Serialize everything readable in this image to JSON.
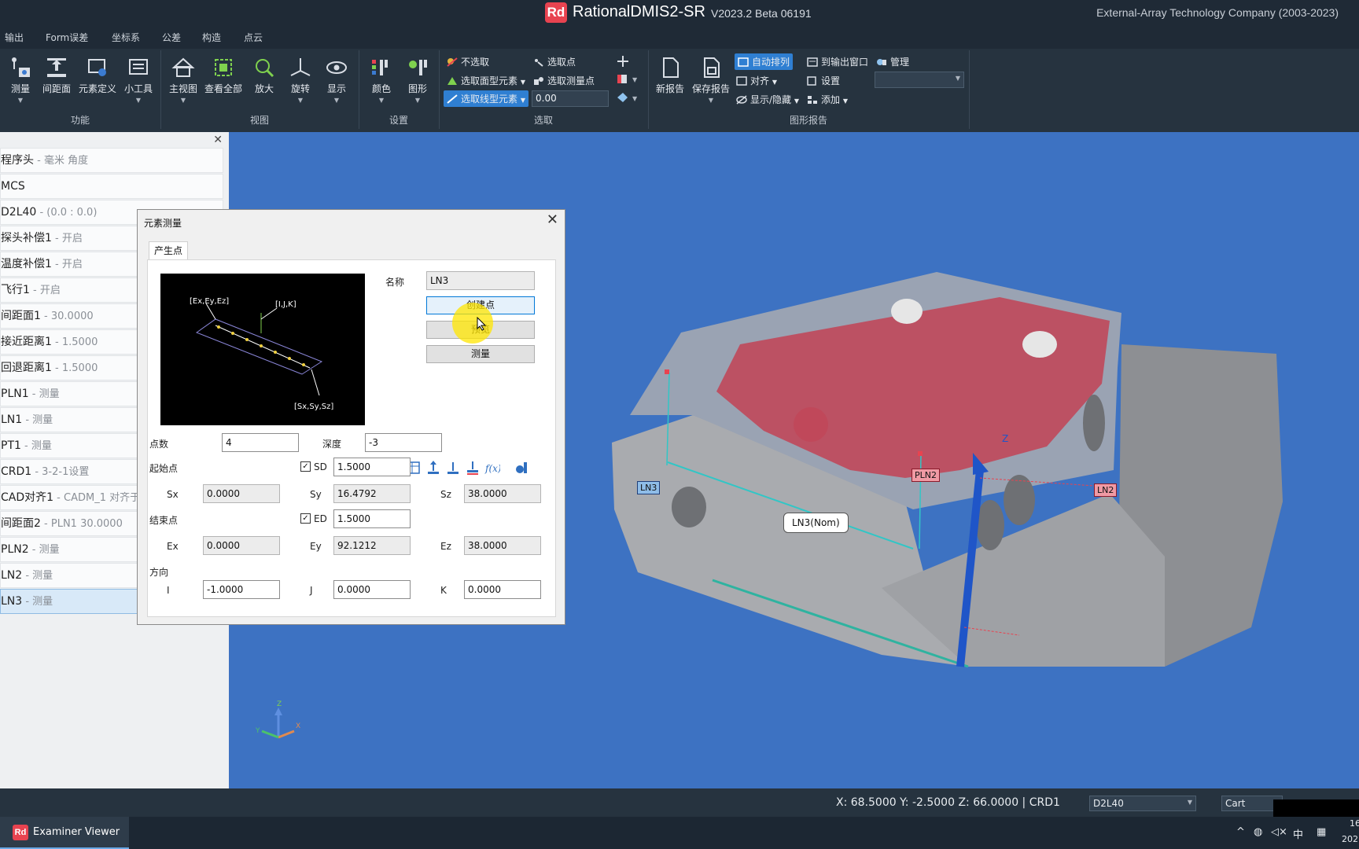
{
  "app": {
    "logo_text": "Rd",
    "title": "RationalDMIS2-SR",
    "version": "V2023.2 Beta 06191",
    "company": "External-Array Technology Company (2003-2023)"
  },
  "menu": [
    "输出",
    "Form误差",
    "坐标系",
    "公差",
    "构造",
    "点云"
  ],
  "ribbon": {
    "function_buttons": [
      "测量",
      "间距面",
      "元素定义",
      "小工具"
    ],
    "function_group": "功能",
    "view_buttons": [
      "主视图",
      "查看全部",
      "放大",
      "旋转",
      "显示"
    ],
    "view_group": "视图",
    "settings_buttons": [
      "颜色",
      "图形"
    ],
    "settings_group": "设置",
    "select_items": {
      "no_select": "不选取",
      "select_point": "选取点",
      "select_surface": "选取面型元素",
      "select_measured_point": "选取测量点",
      "select_linear": "选取线型元素",
      "value": "0.00"
    },
    "select_group": "选取",
    "report_buttons": [
      "新报告",
      "保存报告"
    ],
    "report_items": {
      "auto_arrange": "自动排列",
      "to_output": "到输出窗口",
      "manage": "管理",
      "align": "对齐",
      "settings": "设置",
      "show_hide": "显示/隐藏",
      "add": "添加"
    },
    "report_group": "图形报告"
  },
  "program_tree": [
    {
      "name": "程序头",
      "detail": " - 毫米 角度"
    },
    {
      "name": "MCS",
      "detail": ""
    },
    {
      "name": "D2L40",
      "detail": " - (0.0 : 0.0)"
    },
    {
      "name": "探头补偿1",
      "detail": " - 开启"
    },
    {
      "name": "温度补偿1",
      "detail": " - 开启"
    },
    {
      "name": "飞行1",
      "detail": " - 开启"
    },
    {
      "name": "间距面1",
      "detail": " - 30.0000"
    },
    {
      "name": "接近距离1",
      "detail": " - 1.5000"
    },
    {
      "name": "回退距离1",
      "detail": " - 1.5000"
    },
    {
      "name": "PLN1",
      "detail": " - 测量"
    },
    {
      "name": "LN1",
      "detail": " - 测量"
    },
    {
      "name": "PT1",
      "detail": " - 测量"
    },
    {
      "name": "CRD1",
      "detail": " - 3-2-1设置"
    },
    {
      "name": "CAD对齐1",
      "detail": " - CADM_1 对齐于 CRD1"
    },
    {
      "name": "间距面2",
      "detail": " - PLN1 30.0000"
    },
    {
      "name": "PLN2",
      "detail": " - 测量"
    },
    {
      "name": "LN2",
      "detail": " - 测量"
    },
    {
      "name": "LN3",
      "detail": " - 测量"
    }
  ],
  "dialog": {
    "title": "元素测量",
    "tab": "产生点",
    "preview": {
      "label_end": "[Ex,Ey,Ez]",
      "label_dir": "[I,J,K]",
      "label_start": "[Sx,Sy,Sz]"
    },
    "name_label": "名称",
    "name_value": "LN3",
    "buttons": {
      "create": "创建点",
      "preview": "预览",
      "measure": "测量"
    },
    "points_label": "点数",
    "points_value": "4",
    "depth_label": "深度",
    "depth_value": "-3",
    "start_label": "起始点",
    "sd_label": "SD",
    "sd_value": "1.5000",
    "sx_label": "Sx",
    "sx": "0.0000",
    "sy_label": "Sy",
    "sy": "16.4792",
    "sz_label": "Sz",
    "sz": "38.0000",
    "end_label": "结束点",
    "ed_label": "ED",
    "ed_value": "1.5000",
    "ex_label": "Ex",
    "ex": "0.0000",
    "ey_label": "Ey",
    "ey": "92.1212",
    "ez_label": "Ez",
    "ez": "38.0000",
    "dir_label": "方向",
    "i_label": "I",
    "i": "-1.0000",
    "j_label": "J",
    "j": "0.0000",
    "k_label": "K",
    "k": "0.0000"
  },
  "viewport": {
    "labels": {
      "ln3": "LN3",
      "pln2": "PLN2",
      "ln2": "LN2",
      "callout": "LN3(Nom)",
      "axis_z": "Z"
    },
    "triad": {
      "x": "X",
      "y": "Y",
      "z": "Z"
    }
  },
  "status": {
    "coords": "X: 68.5000   Y: -2.5000   Z: 66.0000  |  CRD1",
    "crd_select": "D2L40",
    "mode_select": "Cart"
  },
  "taskbar": {
    "task_logo": "Rd",
    "task_title": "Examiner Viewer",
    "ime": "中",
    "time_partial": "16",
    "date_partial": "202"
  }
}
